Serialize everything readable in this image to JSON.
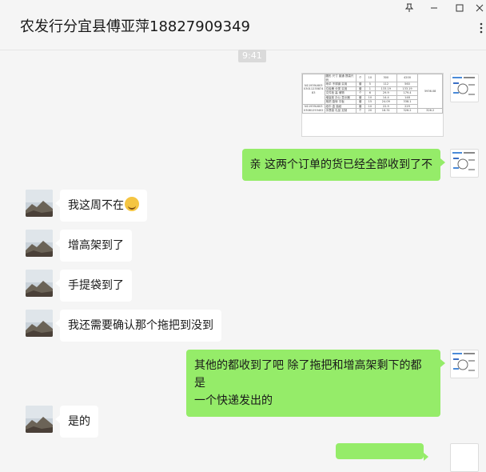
{
  "header": {
    "title": "农发行分宜县傅亚萍18827909349"
  },
  "window": {
    "pin_icon": "pin-icon",
    "minimize_icon": "minimize-icon",
    "maximize_icon": "maximize-icon",
    "close_icon": "close-icon",
    "more_icon": "more-icon"
  },
  "chat": {
    "time_label": "9:41",
    "messages": [
      {
        "side": "right",
        "type": "image"
      },
      {
        "side": "right",
        "type": "text",
        "text": "亲 这两个订单的货已经全部收到了不"
      },
      {
        "side": "left",
        "type": "text",
        "text": "我这周不在"
      },
      {
        "side": "left",
        "type": "text",
        "text": "增高架到了"
      },
      {
        "side": "left",
        "type": "text",
        "text": "手提袋到了"
      },
      {
        "side": "left",
        "type": "text",
        "text": "我还需要确认那个拖把到没到"
      },
      {
        "side": "right",
        "type": "text",
        "text": "其他的都收到了吧 除了拖把和增高架剩下的都是",
        "text2": "一个快递发出的"
      },
      {
        "side": "left",
        "type": "text",
        "text": "是的"
      }
    ]
  },
  "order_image": {
    "order_ids": [
      "N11939L603 03011235874 83",
      "N11939L603 03081253402"
    ],
    "rows": [
      {
        "desc": "圆形 尺寸 普通 提袋尺码",
        "unit": "个",
        "qty": "10",
        "price": "300",
        "amount": "4200"
      },
      {
        "desc": "雨伞 不锈钢 实用",
        "unit": "套",
        "qty": "5",
        "price": "112",
        "amount": "560"
      },
      {
        "desc": "垃圾桶 分类 实用",
        "unit": "套",
        "qty": "1",
        "price": "133.19",
        "amount": "133.19"
      },
      {
        "desc": "文件柜 高 储物",
        "unit": "个",
        "qty": "6",
        "price": "29.9",
        "amount": "179.4"
      },
      {
        "desc": "增高架 办公 显示器",
        "unit": "套",
        "qty": "10",
        "price": "14.4",
        "amount": "148"
      },
      {
        "desc": "拖把 旋转 平板",
        "unit": "套",
        "qty": "15",
        "price": "24.09",
        "amount": "338.1"
      },
      {
        "desc": "纸巾 盒 抽纸",
        "unit": "套",
        "qty": "10",
        "price": "22.9",
        "amount": "229"
      },
      {
        "desc": "手提袋 礼品 定制",
        "unit": "个",
        "qty": "20",
        "price": "16.31",
        "amount": "326.2"
      }
    ],
    "totals": [
      "5936.08",
      "326.2"
    ]
  },
  "thumb_text": [
    "发货单",
    "订单"
  ]
}
